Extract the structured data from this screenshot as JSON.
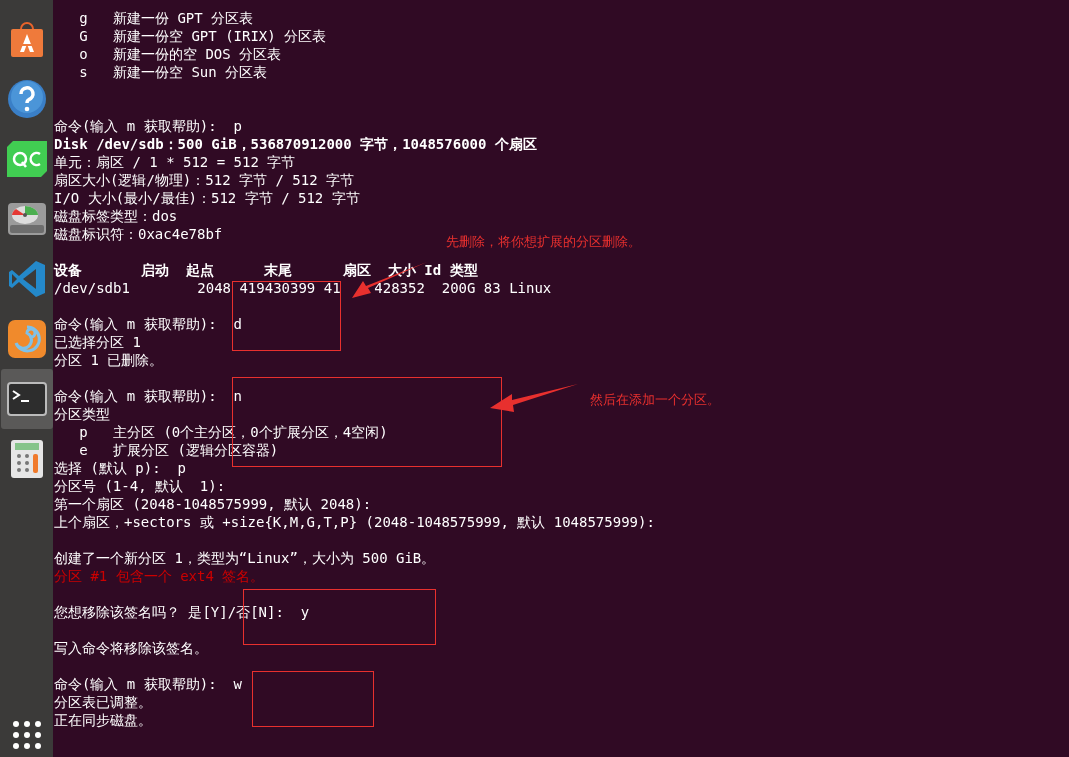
{
  "dock": [
    {
      "kind": "store",
      "selected": false
    },
    {
      "kind": "help",
      "selected": false
    },
    {
      "kind": "qc",
      "selected": false
    },
    {
      "kind": "disk",
      "selected": false
    },
    {
      "kind": "code",
      "selected": false
    },
    {
      "kind": "swirl",
      "selected": false
    },
    {
      "kind": "terminal",
      "selected": true
    },
    {
      "kind": "calculator",
      "selected": false
    },
    {
      "kind": "grid",
      "selected": false
    }
  ],
  "terminal_lines": [
    {
      "kind": "blank"
    },
    {
      "kind": "text",
      "text": "   g   新建一份 GPT 分区表"
    },
    {
      "kind": "text",
      "text": "   G   新建一份空 GPT (IRIX) 分区表"
    },
    {
      "kind": "text",
      "text": "   o   新建一份的空 DOS 分区表"
    },
    {
      "kind": "text",
      "text": "   s   新建一份空 Sun 分区表"
    },
    {
      "kind": "blank"
    },
    {
      "kind": "blank"
    },
    {
      "kind": "text",
      "text": "命令(输入 m 获取帮助):  p"
    },
    {
      "kind": "bold",
      "text": "Disk /dev/sdb：500 GiB，536870912000 字节，1048576000 个扇区"
    },
    {
      "kind": "text",
      "text": "单元：扇区 / 1 * 512 = 512 字节"
    },
    {
      "kind": "text",
      "text": "扇区大小(逻辑/物理)：512 字节 / 512 字节"
    },
    {
      "kind": "text",
      "text": "I/O 大小(最小/最佳)：512 字节 / 512 字节"
    },
    {
      "kind": "text",
      "text": "磁盘标签类型：dos"
    },
    {
      "kind": "text",
      "text": "磁盘标识符：0xac4e78bf"
    },
    {
      "kind": "blank"
    },
    {
      "kind": "bold",
      "text": "设备       启动  起点      末尾      扇区  大小 Id 类型"
    },
    {
      "kind": "split",
      "segments": [
        "/dev/sdb1        2048 419430399 41",
        "428352  200G 83 Linux"
      ]
    },
    {
      "kind": "blank"
    },
    {
      "kind": "text",
      "text": "命令(输入 m 获取帮助):  d"
    },
    {
      "kind": "text",
      "text": "已选择分区 1"
    },
    {
      "kind": "text",
      "text": "分区 1 已删除。"
    },
    {
      "kind": "blank"
    },
    {
      "kind": "text",
      "text": "命令(输入 m 获取帮助):  n"
    },
    {
      "kind": "text",
      "text": "分区类型"
    },
    {
      "kind": "text",
      "text": "   p   主分区 (0个主分区，0个扩展分区，4空闲)"
    },
    {
      "kind": "text",
      "text": "   e   扩展分区 (逻辑分区容器)"
    },
    {
      "kind": "text",
      "text": "选择 (默认 p):  p"
    },
    {
      "kind": "text",
      "text": "分区号 (1-4, 默认  1):"
    },
    {
      "kind": "text",
      "text": "第一个扇区 (2048-1048575999, 默认 2048):"
    },
    {
      "kind": "text",
      "text": "上个扇区，+sectors 或 +size{K,M,G,T,P} (2048-1048575999, 默认 1048575999):"
    },
    {
      "kind": "blank"
    },
    {
      "kind": "text",
      "text": "创建了一个新分区 1，类型为“Linux”，大小为 500 GiB。"
    },
    {
      "kind": "error",
      "text": "分区 #1 包含一个 ext4 签名。"
    },
    {
      "kind": "blank"
    },
    {
      "kind": "text",
      "text": "您想移除该签名吗？ 是[Y]/否[N]:  y"
    },
    {
      "kind": "blank"
    },
    {
      "kind": "text",
      "text": "写入命令将移除该签名。"
    },
    {
      "kind": "blank"
    },
    {
      "kind": "text",
      "text": "命令(输入 m 获取帮助):  w"
    },
    {
      "kind": "text",
      "text": "分区表已调整。"
    },
    {
      "kind": "text",
      "text": "正在同步磁盘。"
    }
  ],
  "annotations": [
    {
      "text": "先删除，将你想扩展的分区删除。"
    },
    {
      "text": "然后在添加一个分区。"
    }
  ]
}
